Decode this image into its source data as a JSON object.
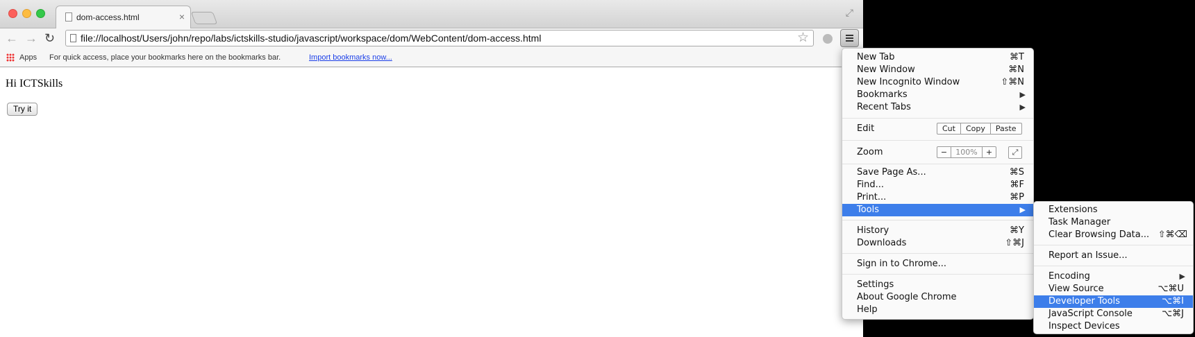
{
  "tab": {
    "title": "dom-access.html",
    "close": "×"
  },
  "toolbar": {
    "back": "←",
    "forward": "→",
    "reload": "↻",
    "url": "file://localhost/Users/john/repo/labs/ictskills-studio/javascript/workspace/dom/WebContent/dom-access.html",
    "star": "☆"
  },
  "bookmarks": {
    "apps_label": "Apps",
    "hint": "For quick access, place your bookmarks here on the bookmarks bar.",
    "import_link": "Import bookmarks now..."
  },
  "page": {
    "greeting": "Hi ICTSkills",
    "button_label": "Try it"
  },
  "menu": {
    "new_tab": {
      "label": "New Tab",
      "shortcut": "⌘T"
    },
    "new_window": {
      "label": "New Window",
      "shortcut": "⌘N"
    },
    "new_incognito": {
      "label": "New Incognito Window",
      "shortcut": "⇧⌘N"
    },
    "bookmarks": {
      "label": "Bookmarks",
      "arrow": "▶"
    },
    "recent_tabs": {
      "label": "Recent Tabs",
      "arrow": "▶"
    },
    "edit": {
      "label": "Edit",
      "cut": "Cut",
      "copy": "Copy",
      "paste": "Paste"
    },
    "zoom": {
      "label": "Zoom",
      "minus": "−",
      "value": "100%",
      "plus": "+",
      "fullscreen": "⤢"
    },
    "save_page": {
      "label": "Save Page As...",
      "shortcut": "⌘S"
    },
    "find": {
      "label": "Find...",
      "shortcut": "⌘F"
    },
    "print": {
      "label": "Print...",
      "shortcut": "⌘P"
    },
    "tools": {
      "label": "Tools",
      "arrow": "▶"
    },
    "history": {
      "label": "History",
      "shortcut": "⌘Y"
    },
    "downloads": {
      "label": "Downloads",
      "shortcut": "⇧⌘J"
    },
    "sign_in": {
      "label": "Sign in to Chrome..."
    },
    "settings": {
      "label": "Settings"
    },
    "about": {
      "label": "About Google Chrome"
    },
    "help": {
      "label": "Help"
    }
  },
  "tools_menu": {
    "extensions": {
      "label": "Extensions"
    },
    "task_manager": {
      "label": "Task Manager"
    },
    "clear_browsing": {
      "label": "Clear Browsing Data...",
      "shortcut": "⇧⌘⌫"
    },
    "report_issue": {
      "label": "Report an Issue..."
    },
    "encoding": {
      "label": "Encoding",
      "arrow": "▶"
    },
    "view_source": {
      "label": "View Source",
      "shortcut": "⌥⌘U"
    },
    "developer_tools": {
      "label": "Developer Tools",
      "shortcut": "⌥⌘I"
    },
    "js_console": {
      "label": "JavaScript Console",
      "shortcut": "⌥⌘J"
    },
    "inspect_devices": {
      "label": "Inspect Devices"
    }
  },
  "colors": {
    "highlight": "#3d7eea",
    "link": "#1a3ee8"
  }
}
